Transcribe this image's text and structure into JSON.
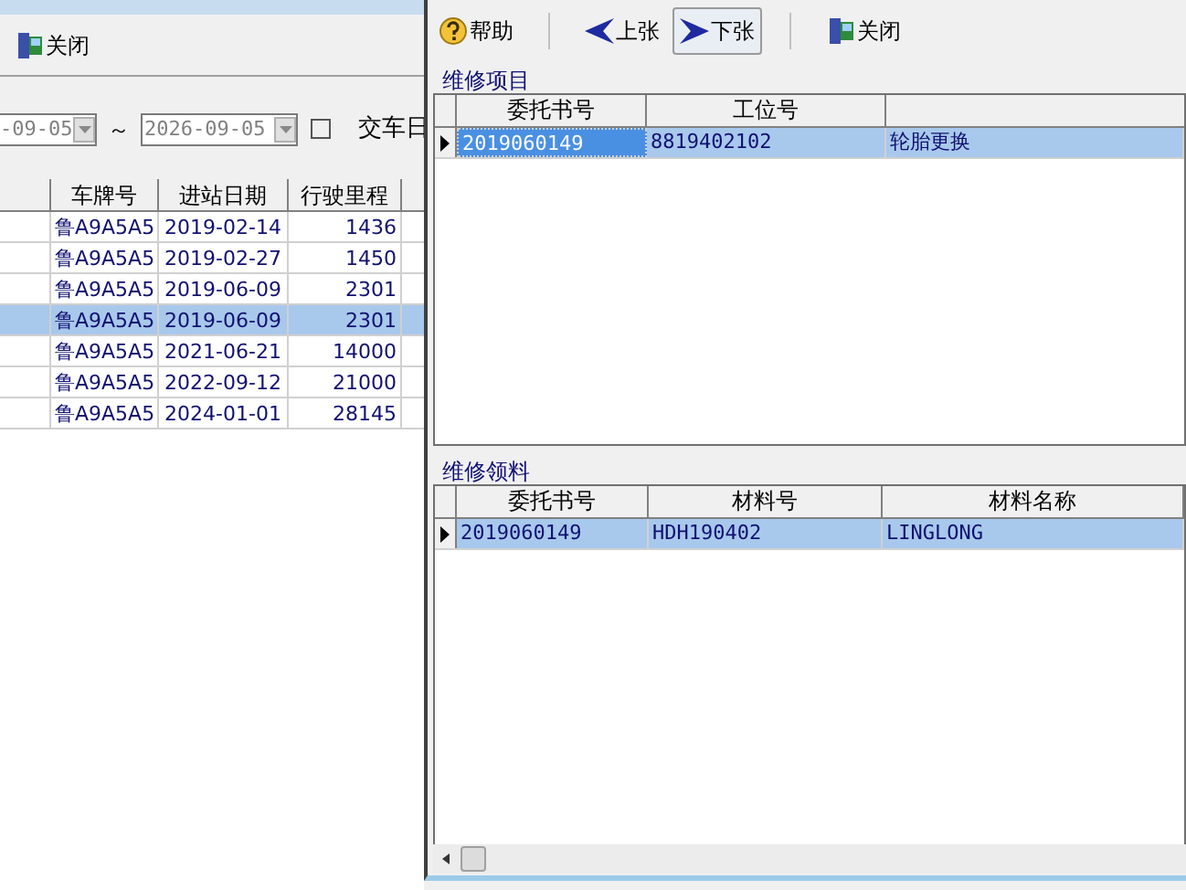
{
  "back_window": {
    "toolbar": [
      {
        "kind": "close",
        "label": "关闭"
      }
    ],
    "date_from": "-09-05",
    "date_separator": "～",
    "date_to": "2026-09-05",
    "checkbox": {
      "checked": false
    },
    "checkbox_label": "交车日",
    "table": {
      "columns": [
        "车牌号",
        "进站日期",
        "行驶里程"
      ],
      "rows": [
        {
          "cells": [
            "鲁A9A5A5",
            "2019-02-14",
            "1436"
          ],
          "selected": false
        },
        {
          "cells": [
            "鲁A9A5A5",
            "2019-02-27",
            "1450"
          ],
          "selected": false
        },
        {
          "cells": [
            "鲁A9A5A5",
            "2019-06-09",
            "2301"
          ],
          "selected": false
        },
        {
          "cells": [
            "鲁A9A5A5",
            "2019-06-09",
            "2301"
          ],
          "selected": true
        },
        {
          "cells": [
            "鲁A9A5A5",
            "2021-06-21",
            "14000"
          ],
          "selected": false
        },
        {
          "cells": [
            "鲁A9A5A5",
            "2022-09-12",
            "21000"
          ],
          "selected": false
        },
        {
          "cells": [
            "鲁A9A5A5",
            "2024-01-01",
            "28145"
          ],
          "selected": false
        }
      ]
    }
  },
  "front_window": {
    "toolbar": [
      {
        "kind": "help",
        "label": "帮助",
        "pressed": false
      },
      {
        "kind": "prev",
        "label": "上张",
        "pressed": false
      },
      {
        "kind": "next",
        "label": "下张",
        "pressed": true
      },
      {
        "kind": "close",
        "label": "关闭",
        "pressed": false
      }
    ],
    "repair_items": {
      "title": "维修项目",
      "columns": [
        "委托书号",
        "工位号"
      ],
      "rows": [
        {
          "cells": [
            "2019060149",
            "8819402102",
            "轮胎更换"
          ],
          "selected": true
        }
      ]
    },
    "repair_materials": {
      "title": "维修领料",
      "columns": [
        "委托书号",
        "材料号",
        "材料名称"
      ],
      "rows": [
        {
          "cells": [
            "2019060149",
            "HDH190402",
            "LINGLONG"
          ],
          "selected": true
        }
      ]
    }
  }
}
